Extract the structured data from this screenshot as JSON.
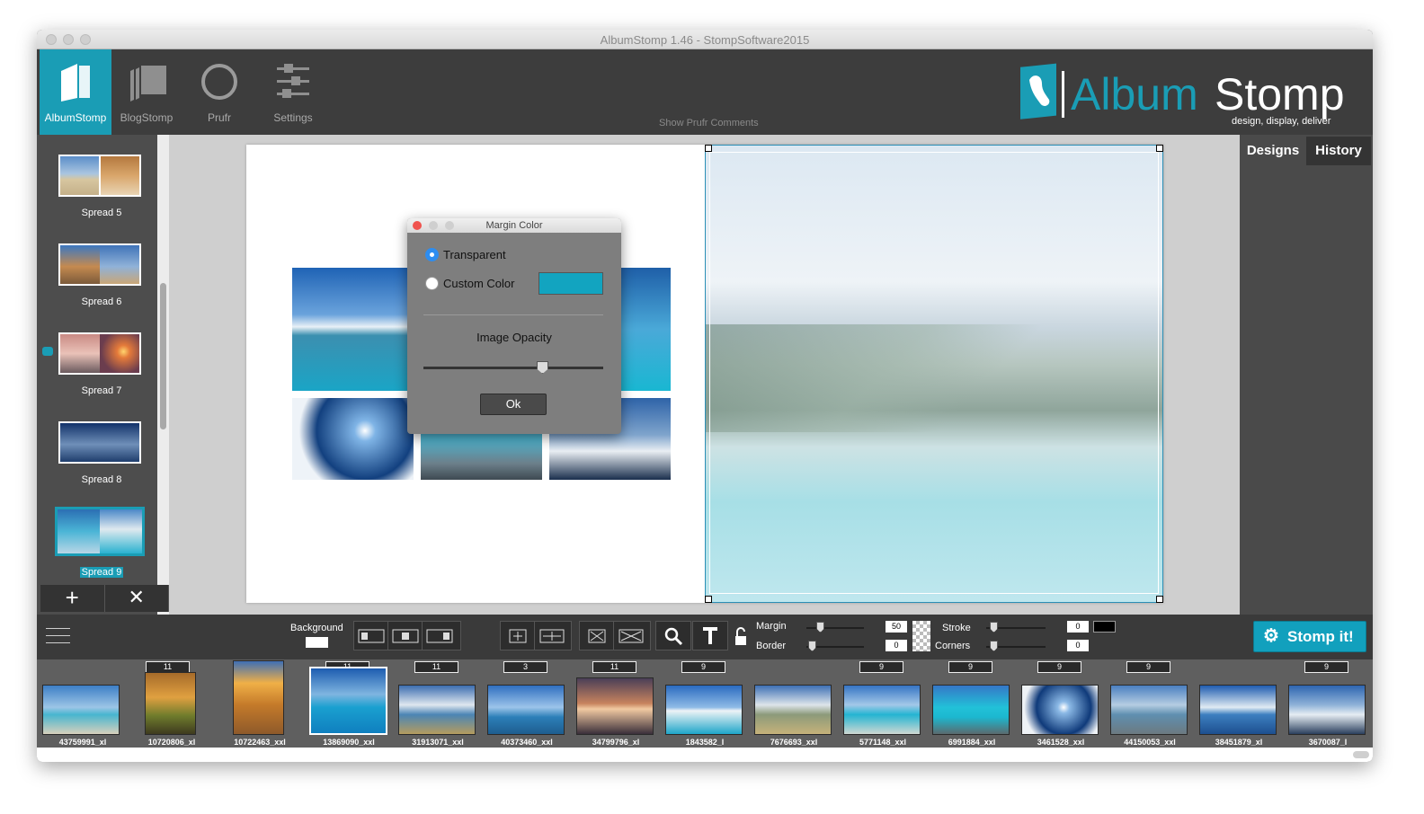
{
  "window": {
    "title": "AlbumStomp 1.46 - StompSoftware2015"
  },
  "toolbar": {
    "tabs": [
      {
        "label": "AlbumStomp",
        "icon": "album-icon",
        "active": true
      },
      {
        "label": "BlogStomp",
        "icon": "blog-stack-icon",
        "active": false
      },
      {
        "label": "Prufr",
        "icon": "prufr-circle-icon",
        "active": false
      },
      {
        "label": "Settings",
        "icon": "sliders-icon",
        "active": false
      }
    ],
    "show_prufr_comments": "Show Prufr Comments"
  },
  "logo": {
    "brand_first": "Album",
    "brand_second": "Stomp",
    "tagline": "design, display, deliver"
  },
  "spreads": [
    {
      "label": "Spread 5",
      "selected": false
    },
    {
      "label": "Spread 6",
      "selected": false
    },
    {
      "label": "Spread 7",
      "selected": false
    },
    {
      "label": "Spread 8",
      "selected": false
    },
    {
      "label": "Spread 9",
      "selected": true
    }
  ],
  "sidebar_actions": {
    "add": "+",
    "remove": "✕"
  },
  "dialog": {
    "title": "Margin Color",
    "option_transparent": "Transparent",
    "option_custom": "Custom Color",
    "selected_option": "Transparent",
    "custom_color": "#12a4c0",
    "opacity_label": "Image Opacity",
    "opacity_value": 0.66,
    "ok_label": "Ok"
  },
  "right_panel": {
    "tabs": [
      {
        "label": "Designs",
        "active": true
      },
      {
        "label": "History",
        "active": false
      }
    ]
  },
  "bottom_toolbar": {
    "background_label": "Background",
    "margin_label": "Margin",
    "margin_value": "50",
    "border_label": "Border",
    "border_value": "0",
    "stroke_label": "Stroke",
    "stroke_value": "0",
    "corners_label": "Corners",
    "corners_value": "0",
    "stomp_label": "Stomp it!"
  },
  "filmstrip": [
    {
      "name": "43759991_xl",
      "count": ""
    },
    {
      "name": "10720806_xl",
      "count": "11"
    },
    {
      "name": "10722463_xxl",
      "count": ""
    },
    {
      "name": "13869090_xxl",
      "count": "11"
    },
    {
      "name": "31913071_xxl",
      "count": "11"
    },
    {
      "name": "40373460_xxl",
      "count": "3"
    },
    {
      "name": "34799796_xl",
      "count": "11"
    },
    {
      "name": "1843582_l",
      "count": "9"
    },
    {
      "name": "7676693_xxl",
      "count": ""
    },
    {
      "name": "5771148_xxl",
      "count": "9"
    },
    {
      "name": "6991884_xxl",
      "count": "9"
    },
    {
      "name": "3461528_xxl",
      "count": "9"
    },
    {
      "name": "44150053_xxl",
      "count": "9"
    },
    {
      "name": "38451879_xl",
      "count": ""
    },
    {
      "name": "3670087_l",
      "count": "9"
    }
  ],
  "colors": {
    "accent": "#1a9db5",
    "toolbar_bg": "#3d3d3d",
    "sidebar_bg": "#4d4d4d"
  }
}
